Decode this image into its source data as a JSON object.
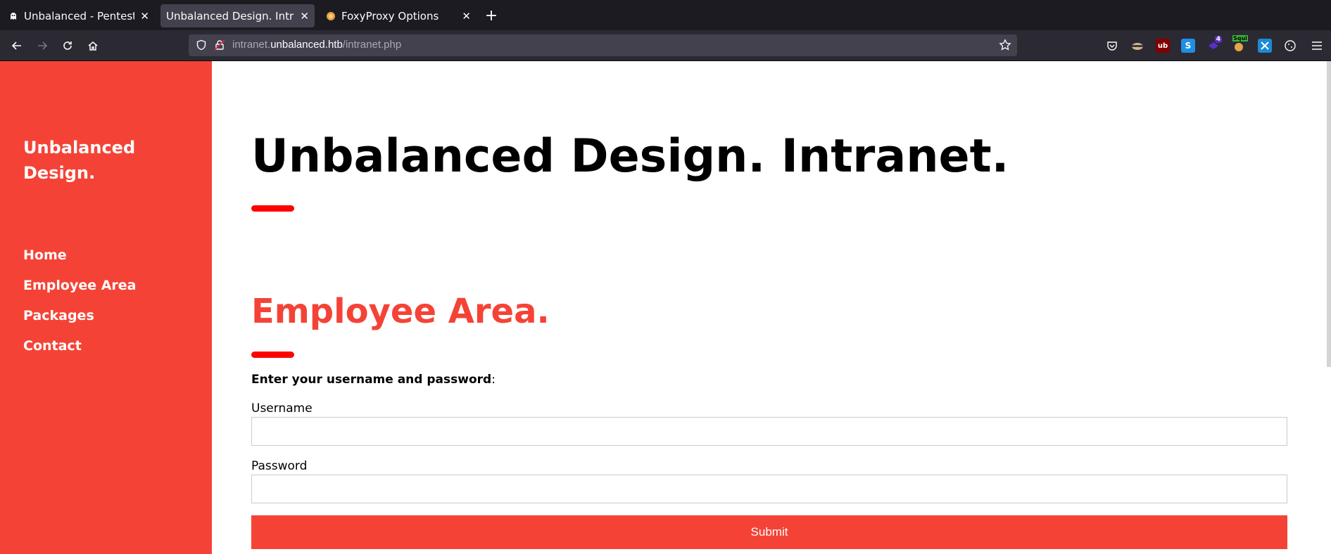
{
  "browser": {
    "tabs": [
      {
        "title": "Unbalanced - Pentesting",
        "icon": "ghost-icon",
        "active": false
      },
      {
        "title": "Unbalanced Design. Intranet",
        "icon": "",
        "active": true
      },
      {
        "title": "FoxyProxy Options",
        "icon": "foxyproxy-icon",
        "active": false
      }
    ],
    "url": {
      "prefix": "intranet.",
      "domain": "unbalanced.htb",
      "path": "/intranet.php"
    },
    "extensions": [
      {
        "name": "pocket-icon",
        "badge": ""
      },
      {
        "name": "ninja-icon",
        "badge": ""
      },
      {
        "name": "ublock-icon",
        "badge": "ub"
      },
      {
        "name": "s-extension-icon",
        "badge": "S"
      },
      {
        "name": "wappalyzer-icon",
        "badge": "4"
      },
      {
        "name": "squirrel-icon",
        "badge": "Squi"
      },
      {
        "name": "extension-x-icon",
        "badge": ""
      },
      {
        "name": "cookie-icon",
        "badge": ""
      }
    ]
  },
  "sidebar": {
    "brand": "Unbalanced Design.",
    "nav": [
      "Home",
      "Employee Area",
      "Packages",
      "Contact"
    ]
  },
  "main": {
    "title": "Unbalanced Design. Intranet.",
    "section_title": "Employee Area.",
    "prompt_bold": "Enter your username and password",
    "prompt_tail": ":",
    "username_label": "Username",
    "username_value": "",
    "password_label": "Password",
    "password_value": "",
    "submit_label": "Submit"
  },
  "colors": {
    "accent": "#f44336",
    "divider": "#ff0000"
  }
}
